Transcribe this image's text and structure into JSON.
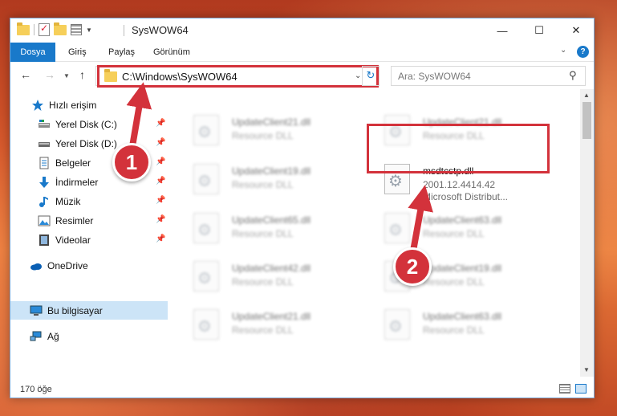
{
  "window": {
    "title": "SysWOW64",
    "minimize_glyph": "—",
    "maximize_glyph": "☐",
    "close_glyph": "✕"
  },
  "ribbon": {
    "tabs": [
      {
        "label": "Dosya"
      },
      {
        "label": "Giriş"
      },
      {
        "label": "Paylaş"
      },
      {
        "label": "Görünüm"
      }
    ],
    "help_glyph": "?"
  },
  "navigation": {
    "address": "C:\\Windows\\SysWOW64",
    "search_placeholder": "Ara: SysWOW64"
  },
  "sidebar": {
    "items": [
      {
        "label": "Hızlı erişim",
        "icon": "star-icon",
        "pinned": false
      },
      {
        "label": "Yerel Disk (C:)",
        "icon": "drive-icon",
        "pinned": true
      },
      {
        "label": "Yerel Disk (D:)",
        "icon": "drive-icon",
        "pinned": true
      },
      {
        "label": "Belgeler",
        "icon": "documents-icon",
        "pinned": true
      },
      {
        "label": "İndirmeler",
        "icon": "downloads-icon",
        "pinned": true
      },
      {
        "label": "Müzik",
        "icon": "music-icon",
        "pinned": true
      },
      {
        "label": "Resimler",
        "icon": "pictures-icon",
        "pinned": true
      },
      {
        "label": "Videolar",
        "icon": "videos-icon",
        "pinned": true
      },
      {
        "label": "OneDrive",
        "icon": "cloud-icon",
        "pinned": false
      },
      {
        "label": "Bu bilgisayar",
        "icon": "computer-icon",
        "pinned": false,
        "selected": true
      },
      {
        "label": "Ağ",
        "icon": "network-icon",
        "pinned": false
      }
    ]
  },
  "files": [
    {
      "name": "UpdateClient21.dll",
      "type": "Resource DLL"
    },
    {
      "name": "UpdateClient21.dll",
      "type": "Resource DLL"
    },
    {
      "name": "UpdateClient19.dll",
      "type": "Resource DLL"
    },
    {
      "name": "msdtcstp.dll",
      "version": "2001.12.4414.42",
      "type": "Microsoft Distribut...",
      "highlighted": true
    },
    {
      "name": "UpdateClient65.dll",
      "type": "Resource DLL"
    },
    {
      "name": "UpdateClient63.dll",
      "type": "Resource DLL"
    },
    {
      "name": "UpdateClient42.dll",
      "type": "Resource DLL"
    },
    {
      "name": "UpdateClient19.dll",
      "type": "Resource DLL"
    },
    {
      "name": "UpdateClient21.dll",
      "type": "Resource DLL"
    },
    {
      "name": "UpdateClient63.dll",
      "type": "Resource DLL"
    }
  ],
  "status": {
    "item_count": "170 öğe"
  },
  "annotations": {
    "step1": "1",
    "step2": "2",
    "highlight_color": "#d3323b"
  },
  "colors": {
    "accent": "#1979ca",
    "selection": "#cce4f7"
  }
}
